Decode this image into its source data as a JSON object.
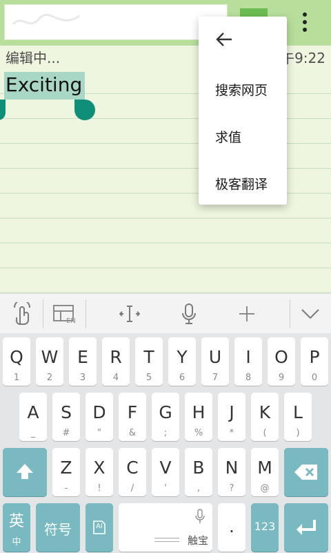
{
  "status": {
    "left": "编辑中...",
    "right": "午9:22"
  },
  "note": {
    "selected_text": "Exciting"
  },
  "popup": {
    "items": [
      "搜索网页",
      "求值",
      "极客翻译"
    ]
  },
  "keyboard": {
    "row1": [
      {
        "m": "Q",
        "s": "1"
      },
      {
        "m": "W",
        "s": "2"
      },
      {
        "m": "E",
        "s": "3"
      },
      {
        "m": "R",
        "s": "4"
      },
      {
        "m": "T",
        "s": "5"
      },
      {
        "m": "Y",
        "s": "6"
      },
      {
        "m": "U",
        "s": "7"
      },
      {
        "m": "I",
        "s": "8"
      },
      {
        "m": "O",
        "s": "9"
      },
      {
        "m": "P",
        "s": "0"
      }
    ],
    "row2": [
      {
        "m": "A",
        "s": "_"
      },
      {
        "m": "S",
        "s": "#"
      },
      {
        "m": "D",
        "s": "\""
      },
      {
        "m": "F",
        "s": "&"
      },
      {
        "m": "G",
        "s": ";"
      },
      {
        "m": "H",
        "s": "%"
      },
      {
        "m": "J",
        "s": "*"
      },
      {
        "m": "K",
        "s": "("
      },
      {
        "m": "L",
        "s": ")"
      }
    ],
    "row3": [
      {
        "m": "Z",
        "s": "-"
      },
      {
        "m": "X",
        "s": "!"
      },
      {
        "m": "C",
        "s": "/"
      },
      {
        "m": "V",
        "s": "'"
      },
      {
        "m": "B",
        "s": ","
      },
      {
        "m": "N",
        "s": "?"
      },
      {
        "m": "M",
        "s": "@"
      }
    ],
    "lang": {
      "main": "英",
      "sub": "中"
    },
    "symbols": "符号",
    "space_label": "触宝",
    "period": ".",
    "numbers": "123",
    "ai": "AI"
  },
  "colors": {
    "teal": "#79b9c1",
    "handle": "#0f8f78",
    "topbar": "#b7df9b"
  }
}
